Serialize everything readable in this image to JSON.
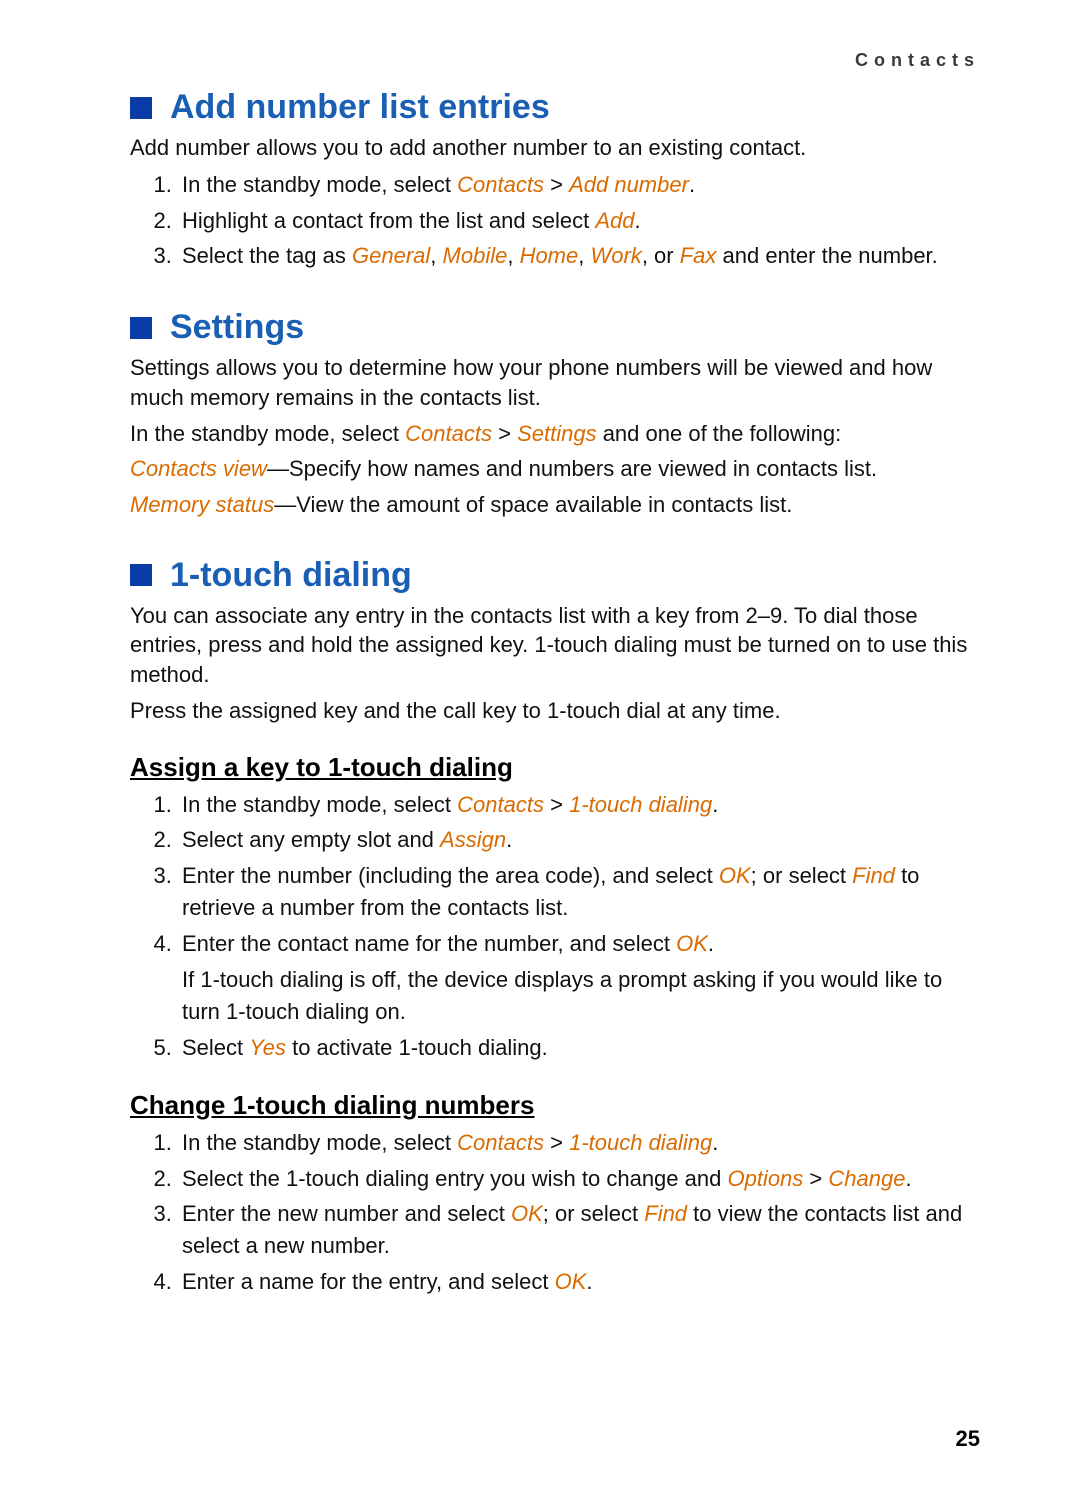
{
  "runningHeader": "Contacts",
  "pageNumber": "25",
  "sections": {
    "addNumber": {
      "title": "Add number list entries",
      "intro": "Add number allows you to add another number to an existing contact.",
      "steps": {
        "s1_pre": "In the standby mode, select ",
        "s1_menu1": "Contacts",
        "s1_mid": " > ",
        "s1_menu2": "Add number",
        "s1_post": ".",
        "s2_pre": "Highlight a contact from the list and select ",
        "s2_menu": "Add",
        "s2_post": ".",
        "s3_pre": "Select the tag as ",
        "s3_m1": "General",
        "s3_c1": ", ",
        "s3_m2": "Mobile",
        "s3_c2": ", ",
        "s3_m3": "Home",
        "s3_c3": ", ",
        "s3_m4": "Work",
        "s3_c4": ", or ",
        "s3_m5": "Fax",
        "s3_post": " and enter the number."
      }
    },
    "settings": {
      "title": "Settings",
      "intro": "Settings allows you to determine how your phone numbers will be viewed and how much memory remains in the contacts list.",
      "p2_pre": "In the standby mode, select ",
      "p2_m1": "Contacts",
      "p2_mid": " > ",
      "p2_m2": "Settings",
      "p2_post": " and one of the following:",
      "p3_m": "Contacts view",
      "p3_post": "—Specify how names and numbers are viewed in contacts list.",
      "p4_m": "Memory status",
      "p4_post": "—View the amount of space available in contacts list."
    },
    "oneTouch": {
      "title": "1-touch dialing",
      "intro": "You can associate any entry in the contacts list with a key from 2–9. To dial those entries, press and hold the assigned key. 1-touch dialing must be turned on to use this method.",
      "p2": "Press the assigned key and the call key to 1-touch dial at any time.",
      "assign": {
        "title": "Assign a key to 1-touch dialing",
        "s1_pre": "In the standby mode, select ",
        "s1_m1": "Contacts",
        "s1_mid": " > ",
        "s1_m2": "1-touch dialing",
        "s1_post": ".",
        "s2_pre": "Select any empty slot and ",
        "s2_m": "Assign",
        "s2_post": ".",
        "s3_pre": "Enter the number (including the area code), and select ",
        "s3_m1": "OK",
        "s3_mid": "; or select ",
        "s3_m2": "Find",
        "s3_post": " to retrieve a number from the contacts list.",
        "s4_pre": "Enter the contact name for the number, and select ",
        "s4_m": "OK",
        "s4_post": ".",
        "s4_note": "If 1-touch dialing is off, the device displays a prompt asking if you would like to turn 1-touch dialing on.",
        "s5_pre": "Select ",
        "s5_m": "Yes",
        "s5_post": " to activate 1-touch dialing."
      },
      "change": {
        "title": "Change 1-touch dialing numbers",
        "s1_pre": "In the standby mode, select ",
        "s1_m1": "Contacts",
        "s1_mid": " > ",
        "s1_m2": "1-touch dialing",
        "s1_post": ".",
        "s2_pre": "Select the 1-touch dialing entry you wish to change and ",
        "s2_m1": "Options",
        "s2_mid": " > ",
        "s2_m2": "Change",
        "s2_post": ".",
        "s3_pre": "Enter the new number and select ",
        "s3_m1": "OK",
        "s3_mid": "; or select ",
        "s3_m2": "Find",
        "s3_post": " to view the contacts list and select a new number.",
        "s4_pre": "Enter a name for the entry, and select ",
        "s4_m": "OK",
        "s4_post": "."
      }
    }
  }
}
